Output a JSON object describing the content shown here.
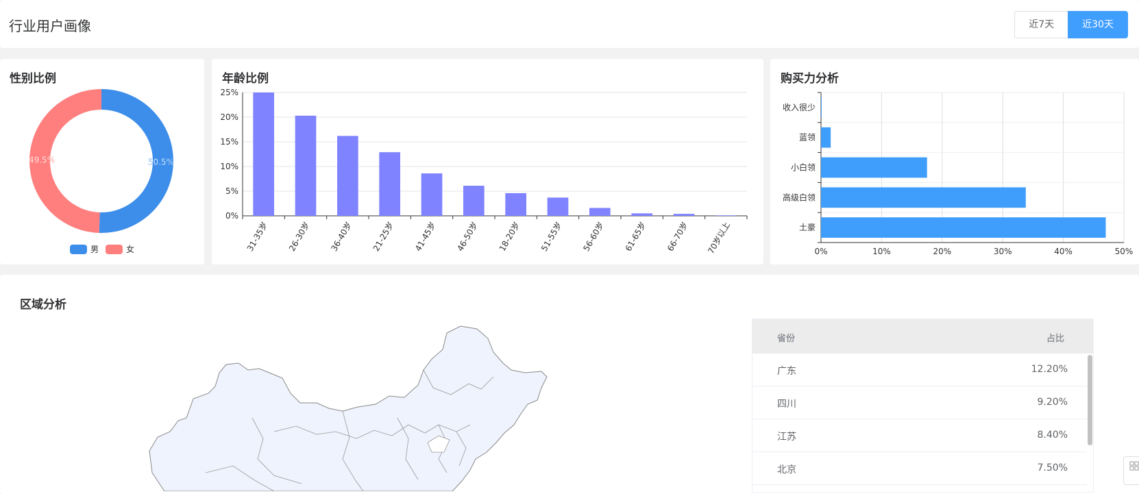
{
  "header": {
    "title": "行业用户画像",
    "btn_7": "近7天",
    "btn_30": "近30天",
    "active": "近30天"
  },
  "gender": {
    "title": "性别比例",
    "colors": {
      "male": "#3d8eea",
      "female": "#ff7f7f"
    }
  },
  "age": {
    "title": "年龄比例"
  },
  "power": {
    "title": "购买力分析"
  },
  "region": {
    "title": "区域分析",
    "table": {
      "col_province": "省份",
      "col_ratio": "占比",
      "rows": [
        {
          "province": "广东",
          "ratio": "12.20%"
        },
        {
          "province": "四川",
          "ratio": "9.20%"
        },
        {
          "province": "江苏",
          "ratio": "8.40%"
        },
        {
          "province": "北京",
          "ratio": "7.50%"
        }
      ]
    }
  },
  "chart_data": [
    {
      "type": "pie",
      "labels": [
        "男",
        "女"
      ],
      "values": [
        50.5,
        49.5
      ],
      "data_labels": [
        "50.5%",
        "49.5%"
      ],
      "legend": "bottom"
    },
    {
      "type": "bar",
      "categories": [
        "31-35岁",
        "26-30岁",
        "36-40岁",
        "21-25岁",
        "41-45岁",
        "46-50岁",
        "18-20岁",
        "51-55岁",
        "56-60岁",
        "61-65岁",
        "66-70岁",
        "70岁以上"
      ],
      "values": [
        25.0,
        20.3,
        16.2,
        12.9,
        8.6,
        6.1,
        4.6,
        3.7,
        1.6,
        0.5,
        0.4,
        0.1
      ],
      "ylim": [
        0,
        25
      ],
      "yticks": [
        "0%",
        "5%",
        "10%",
        "15%",
        "20%",
        "25%"
      ],
      "color": "#7f83ff"
    },
    {
      "type": "bar",
      "orientation": "horizontal",
      "categories": [
        "收入很少",
        "蓝领",
        "小白领",
        "高级白领",
        "土豪"
      ],
      "values": [
        0.1,
        1.6,
        17.5,
        33.8,
        47.0
      ],
      "xlim": [
        0,
        50
      ],
      "xticks": [
        "0%",
        "10%",
        "20%",
        "30%",
        "40%",
        "50%"
      ],
      "color": "#3f9dfb"
    }
  ]
}
